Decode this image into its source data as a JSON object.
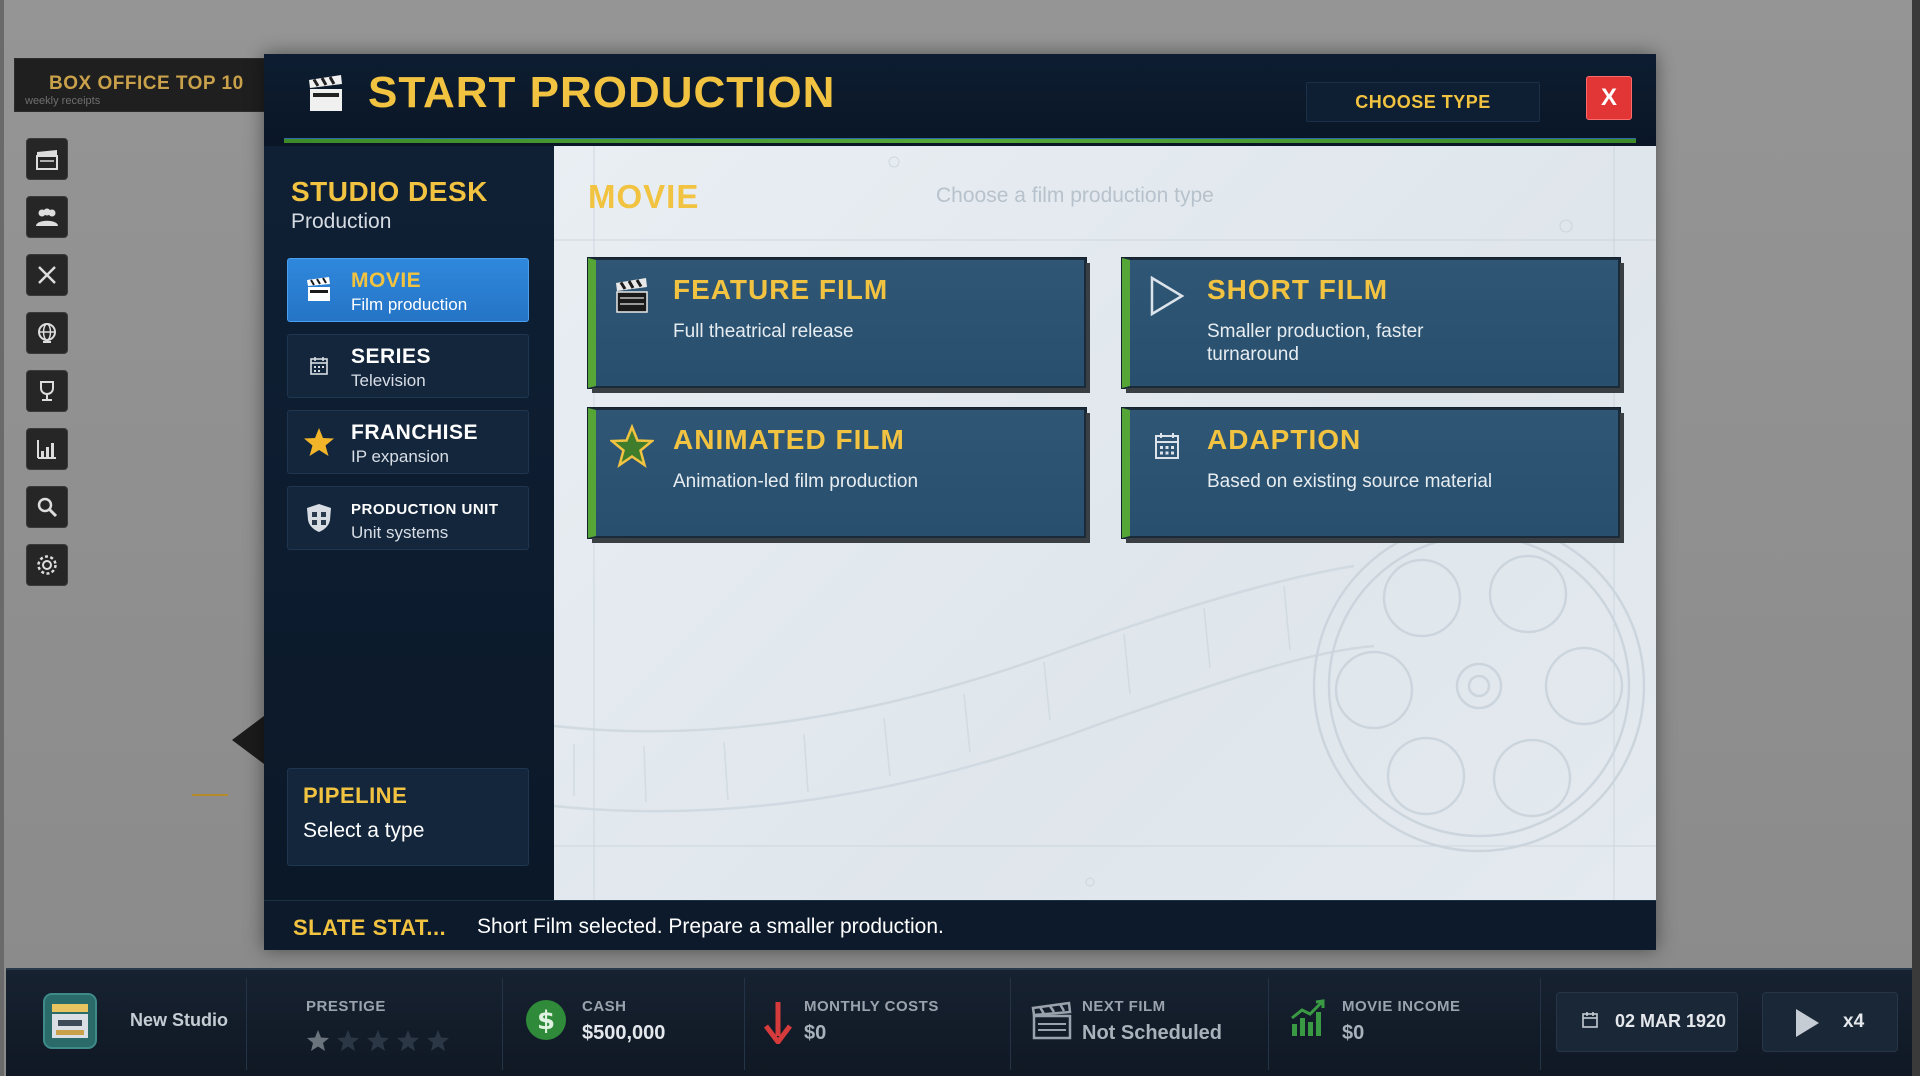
{
  "left_panel": {
    "box_office_title": "BOX OFFICE TOP 10",
    "box_office_sub": "weekly receipts",
    "rail_icons": [
      "clapper-icon",
      "people-icon",
      "tools-icon",
      "globe-icon",
      "trophy-icon",
      "chart-icon",
      "search-icon",
      "gear-icon"
    ]
  },
  "modal": {
    "title": "START PRODUCTION",
    "choose_type_label": "CHOOSE TYPE",
    "close_label": "X",
    "sidebar": {
      "title": "STUDIO DESK",
      "subtitle": "Production",
      "items": [
        {
          "label": "MOVIE",
          "sub": "Film production",
          "icon": "clapper-icon",
          "active": true
        },
        {
          "label": "SERIES",
          "sub": "Television",
          "icon": "calendar-icon",
          "active": false
        },
        {
          "label": "FRANCHISE",
          "sub": "IP expansion",
          "icon": "star-icon",
          "active": false
        },
        {
          "label": "PRODUCTION UNIT",
          "sub": "Unit systems",
          "icon": "shield-icon",
          "active": false
        }
      ],
      "pipeline": {
        "title": "PIPELINE",
        "value": "Select a type"
      }
    },
    "content": {
      "section_title": "MOVIE",
      "hint": "Choose a film production type",
      "cards": [
        {
          "title": "FEATURE FILM",
          "desc": "Full theatrical release",
          "icon": "clapper-icon"
        },
        {
          "title": "SHORT FILM",
          "desc": "Smaller production, faster turnaround",
          "icon": "play-icon"
        },
        {
          "title": "ANIMATED FILM",
          "desc": "Animation-led film production",
          "icon": "star-icon"
        },
        {
          "title": "ADAPTION",
          "desc": "Based on existing source material",
          "icon": "calendar-icon"
        }
      ]
    },
    "status": {
      "label": "SLATE STAT...",
      "text": "Short Film selected. Prepare a smaller production."
    }
  },
  "hud": {
    "studio_name": "New Studio",
    "prestige_label": "PRESTIGE",
    "prestige_stars": 0,
    "cash_label": "CASH",
    "cash_value": "$500,000",
    "monthly_costs_label": "MONTHLY COSTS",
    "monthly_costs_value": "$0",
    "next_film_label": "NEXT FILM",
    "next_film_value": "Not Scheduled",
    "movie_income_label": "MOVIE INCOME",
    "movie_income_value": "$0",
    "date": "02 MAR 1920",
    "speed": "x4"
  },
  "colors": {
    "accent_gold": "#f2c340",
    "active_blue": "#2f88dc",
    "card_green": "#55a636",
    "close_red": "#e23535"
  }
}
